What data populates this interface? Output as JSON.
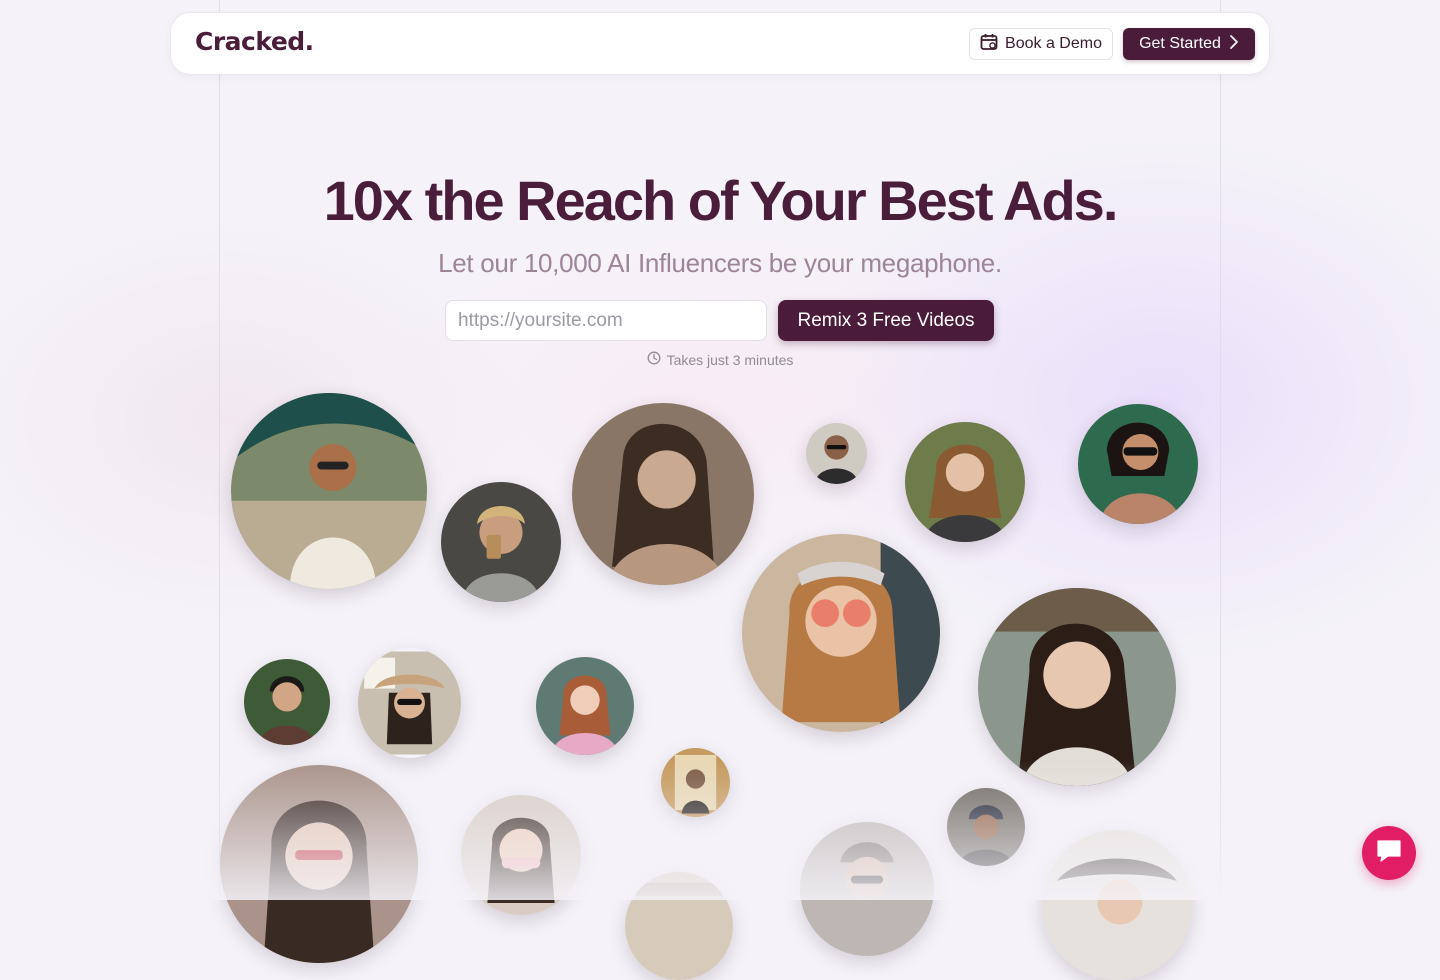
{
  "header": {
    "logo": "Cracked.",
    "book_demo_label": "Book a Demo",
    "get_started_label": "Get Started"
  },
  "hero": {
    "title": "10x the Reach of Your Best Ads.",
    "subtitle": "Let our 10,000 AI Influencers be your megaphone.",
    "url_placeholder": "https://yoursite.com",
    "url_value": "",
    "cta_label": "Remix 3 Free Videos",
    "time_note": "Takes just 3 minutes"
  },
  "icons": {
    "book_demo": "calendar-icon",
    "get_started": "chevron-right-icon",
    "time_note": "clock-icon",
    "chat": "chat-bubble-icon"
  },
  "colors": {
    "brand": "#4a1c3a",
    "subtitle": "#9d8499",
    "background": "#f5f3f9",
    "chat": "#e11d63"
  }
}
